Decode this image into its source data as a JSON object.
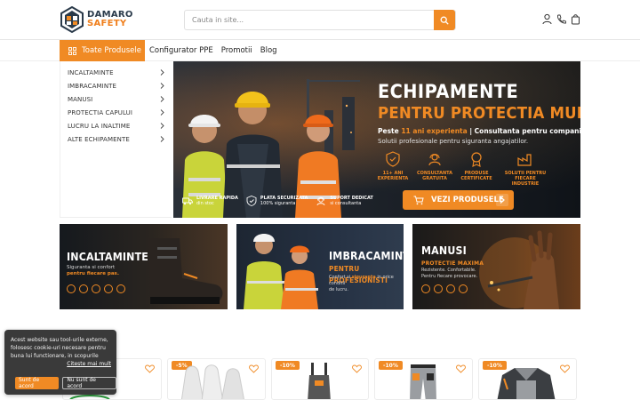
{
  "header": {
    "logo": {
      "line1": "DAMARO",
      "line2": "SAFETY"
    },
    "search": {
      "placeholder": "Cauta in site..."
    },
    "icons": [
      "user-icon",
      "phone-icon",
      "cart-icon"
    ]
  },
  "nav": {
    "all_products": "Toate Produsele",
    "links": [
      "Configurator PPE",
      "Promotii",
      "Blog"
    ]
  },
  "sidebar": {
    "items": [
      {
        "label": "INCALTAMINTE"
      },
      {
        "label": "IMBRACAMINTE"
      },
      {
        "label": "MANUSI"
      },
      {
        "label": "PROTECTIA CAPULUI"
      },
      {
        "label": "LUCRU LA INALTIME"
      },
      {
        "label": "ALTE ECHIPAMENTE"
      }
    ]
  },
  "hero": {
    "title1": "ECHIPAMENTE",
    "title2": "PENTRU PROTECTIA MUNCII",
    "line_pre": "Peste ",
    "line_accent": "11 ani experienta",
    "line_post": " | Consultanta pentru companii",
    "subtitle": "Solutii profesionale pentru siguranta angajatilor.",
    "features": [
      {
        "icon": "shield-icon",
        "line1": "11+ ANI",
        "line2": "EXPERIENTA"
      },
      {
        "icon": "headset-icon",
        "line1": "CONSULTANTA",
        "line2": "GRATUITA"
      },
      {
        "icon": "certificate-icon",
        "line1": "PRODUSE",
        "line2": "CERTIFICATE"
      },
      {
        "icon": "factory-icon",
        "line1": "SOLUTII PENTRU",
        "line2": "FIECARE INDUSTRIE"
      }
    ],
    "cta": "VEZI PRODUSELE",
    "perks": [
      {
        "icon": "truck-icon",
        "title": "LIVRARE RAPIDA",
        "sub": "din stoc"
      },
      {
        "icon": "secure-payment-icon",
        "title": "PLATA SECURIZATA",
        "sub": "100% siguranta"
      },
      {
        "icon": "support-icon",
        "title": "SUPORT DEDICAT",
        "sub": "si consultanta"
      }
    ],
    "colors": {
      "accent": "#f08a24"
    }
  },
  "categories": [
    {
      "title": "INCALTAMINTE",
      "sub_line1": "Siguranta si confort",
      "sub_line2_accent": "pentru fiecare pas."
    },
    {
      "title_line1": "IMBRACAMINTE",
      "title_line2_accent": "PENTRU PROFESIONISTI",
      "sub_line1_pre": "Confort si ",
      "sub_line1_accent": "siguranta",
      "sub_line1_post": " in orice conditii",
      "sub_line2": "de lucru."
    },
    {
      "title": "MANUSI",
      "title_accent": "PROTECTIE MAXIMA",
      "sub_line1": "Rezistente. Confortabile.",
      "sub_line2": "Pentru fiecare provocare."
    }
  ],
  "products": [
    {
      "badge": ""
    },
    {
      "badge": "-5%"
    },
    {
      "badge": "-10%"
    },
    {
      "badge": "-10%"
    },
    {
      "badge": "-10%"
    }
  ],
  "cookie": {
    "text": "Acest website sau tool-urile externe, folosesc cookie-uri necesare pentru buna lui functionare, in scopurile",
    "link": "Citeste mai mult",
    "accept": "Sunt de acord",
    "decline": "Nu sunt de acord"
  }
}
